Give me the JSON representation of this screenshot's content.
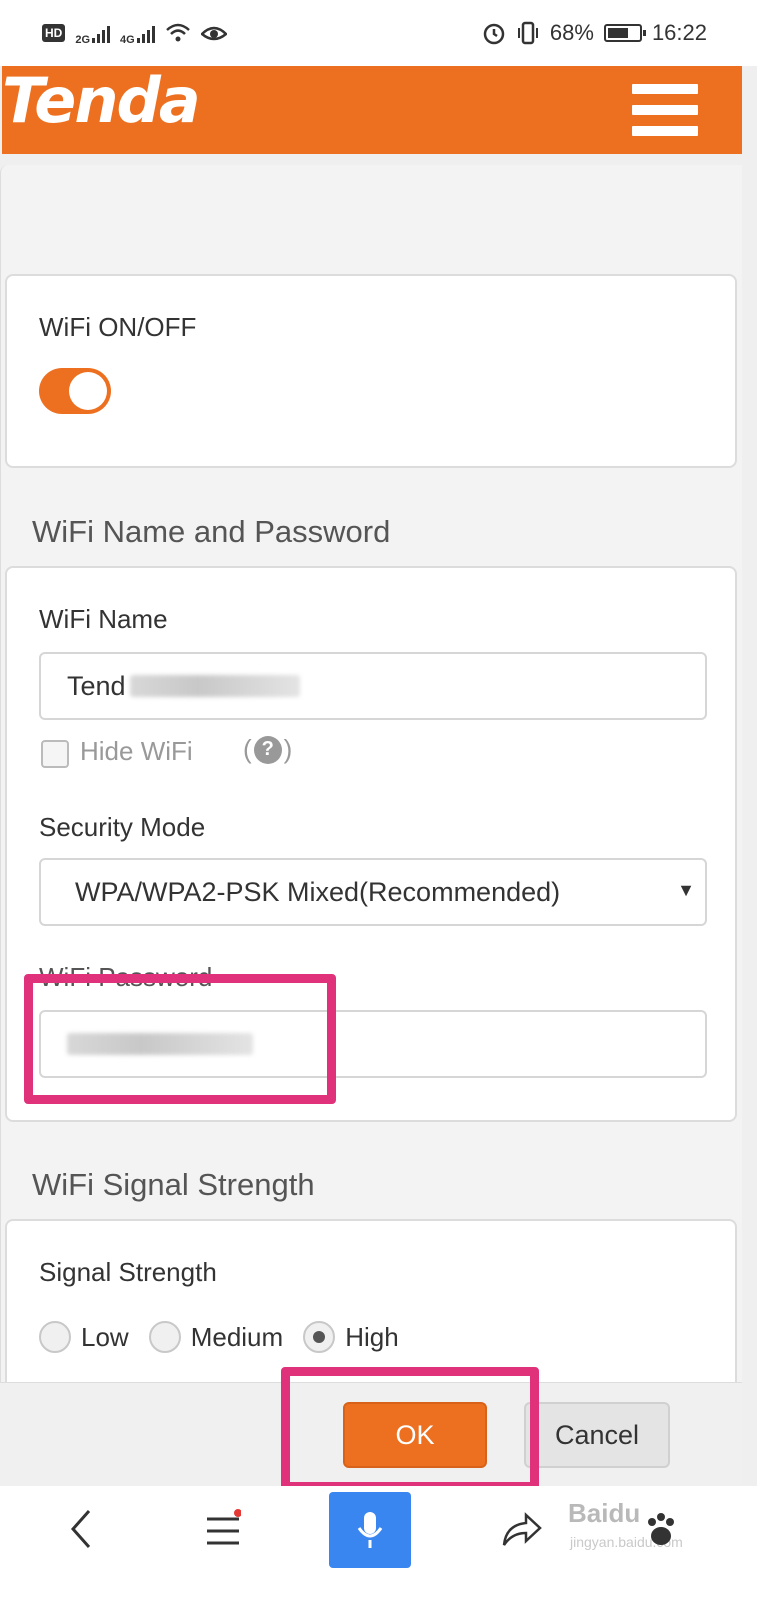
{
  "status_bar": {
    "hd": "HD",
    "net1": "2G",
    "net2": "4G",
    "battery": "68%",
    "time": "16:22"
  },
  "header": {
    "logo": "Tenda"
  },
  "wifi_switch": {
    "label": "WiFi ON/OFF",
    "on": true
  },
  "name_password_section": {
    "title": "WiFi Name and Password",
    "name_label": "WiFi Name",
    "name_value_visible": "Tend",
    "hide_label": "Hide WiFi",
    "help_open": "(",
    "help_icon": "?",
    "help_close": ")",
    "security_label": "Security Mode",
    "security_value": "WPA/WPA2-PSK Mixed(Recommended)",
    "password_label": "WiFi Password"
  },
  "signal_section": {
    "title": "WiFi Signal Strength",
    "label": "Signal Strength",
    "options": [
      "Low",
      "Medium",
      "High"
    ],
    "selected": "High"
  },
  "actions": {
    "ok": "OK",
    "cancel": "Cancel"
  },
  "watermark": {
    "text": "Baidu",
    "sub": "jingyan.baidu.com"
  },
  "colors": {
    "brand": "#ed7020",
    "highlight": "#e0327a",
    "mic": "#3a86f0"
  }
}
